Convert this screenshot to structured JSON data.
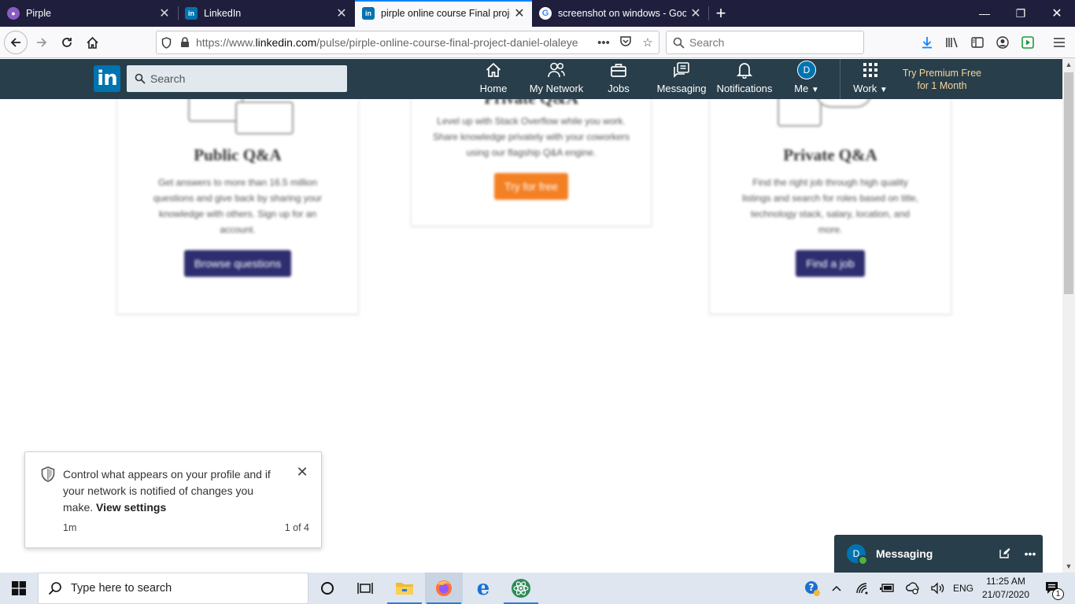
{
  "browser": {
    "tabs": [
      {
        "title": "Pirple",
        "favicon": "pirple-favicon",
        "active": false
      },
      {
        "title": "LinkedIn",
        "favicon": "linkedin-favicon",
        "active": false
      },
      {
        "title": "pirple online course Final proje",
        "favicon": "linkedin-favicon",
        "active": true
      },
      {
        "title": "screenshot on windows - Goog",
        "favicon": "google-favicon",
        "active": false
      }
    ],
    "url_prefix": "https://www.",
    "url_domain": "linkedin.com",
    "url_path": "/pulse/pirple-online-course-final-project-daniel-olaleye",
    "search_placeholder": "Search",
    "accent": "#0a84ff"
  },
  "linkedin": {
    "logo": "in",
    "search_placeholder": "Search",
    "nav": [
      {
        "label": "Home",
        "icon": "home-icon"
      },
      {
        "label": "My Network",
        "icon": "network-icon"
      },
      {
        "label": "Jobs",
        "icon": "briefcase-icon"
      },
      {
        "label": "Messaging",
        "icon": "messaging-icon"
      },
      {
        "label": "Notifications",
        "icon": "bell-icon"
      },
      {
        "label": "Me",
        "icon": "avatar"
      },
      {
        "label": "Work",
        "icon": "grid-icon"
      }
    ],
    "avatar_initial": "D",
    "premium_line1": "Try Premium Free",
    "premium_line2": "for 1 Month",
    "brand_color": "#0073b1",
    "header_color": "#283e4a"
  },
  "content": {
    "card_left": {
      "title": "Public Q&A",
      "text": "Get answers to more than 16.5 million questions and give back by sharing your knowledge with others. Sign up for an account.",
      "button": "Browse questions"
    },
    "card_middle": {
      "title": "Private Q&A",
      "text": "Level up with Stack Overflow while you work. Share knowledge privately with your coworkers using our flagship Q&A engine.",
      "button": "Try for free"
    },
    "card_right": {
      "title": "Private Q&A",
      "text": "Find the right job through high quality listings and search for roles based on title, technology stack, salary, location, and more.",
      "button": "Find a job"
    }
  },
  "toast": {
    "message": "Control what appears on your profile and if your network is notified of changes you make.",
    "link": "View settings",
    "time": "1m",
    "count": "1 of 4"
  },
  "messaging": {
    "avatar_initial": "D",
    "label": "Messaging"
  },
  "taskbar": {
    "search_placeholder": "Type here to search",
    "language": "ENG",
    "time": "11:25 AM",
    "date": "21/07/2020",
    "notification_count": "1"
  }
}
